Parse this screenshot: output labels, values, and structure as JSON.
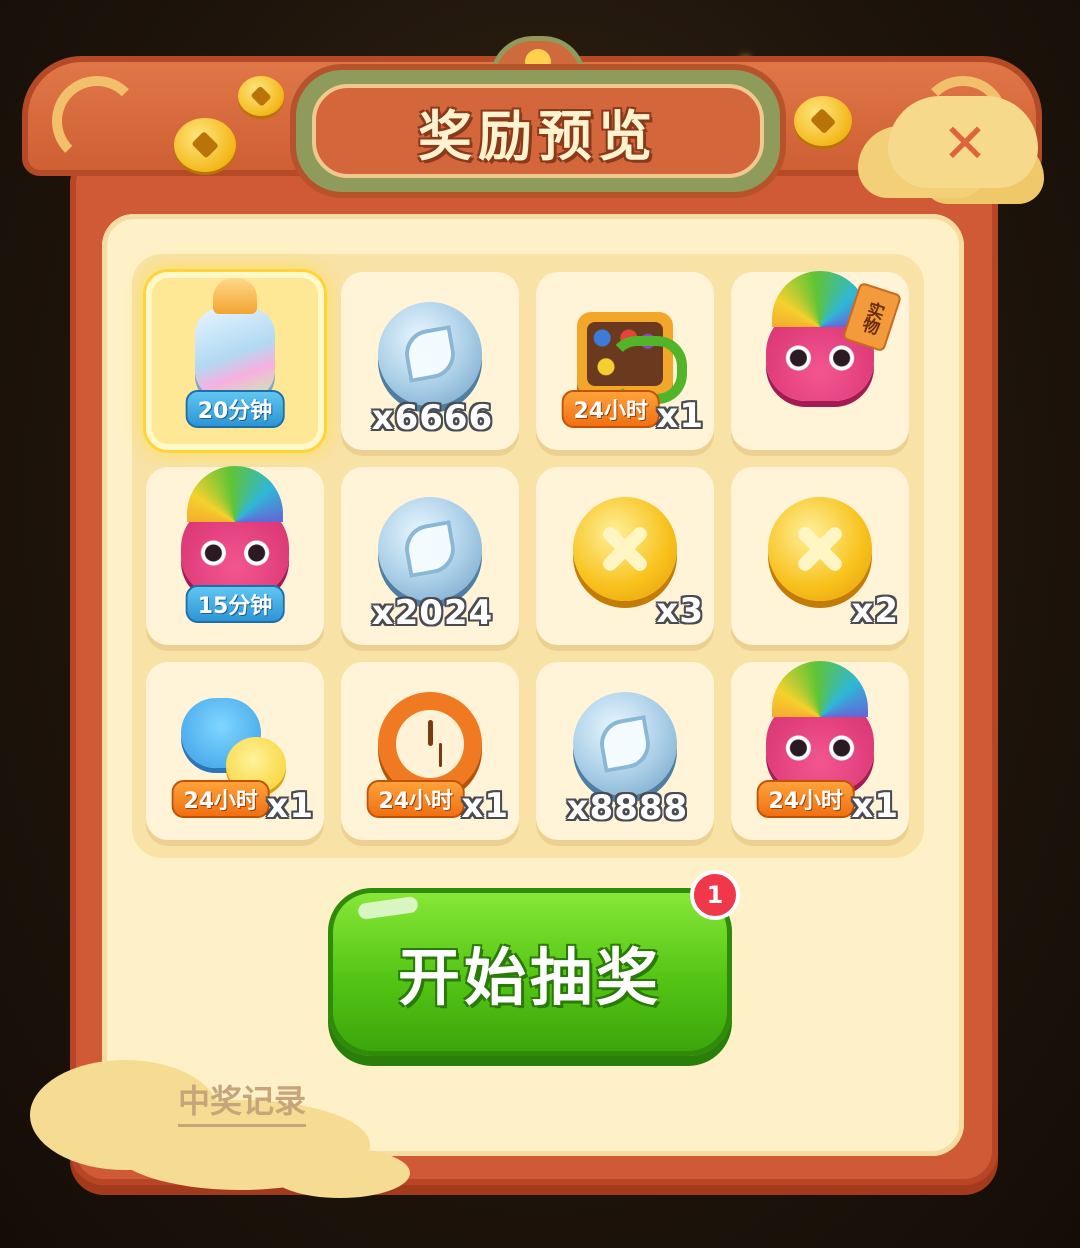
{
  "dialog": {
    "title": "奖励预览",
    "close_icon": "close-icon"
  },
  "rewards": [
    {
      "icon": "bottle-icon",
      "badge": "20分钟",
      "amount": "",
      "selected": true
    },
    {
      "icon": "leaf-coin-icon",
      "badge": "",
      "amount": "x6666"
    },
    {
      "icon": "puzzle-board-icon",
      "badge": "24小时",
      "amount": "x1"
    },
    {
      "icon": "bird-mask-icon",
      "badge": "",
      "amount": "",
      "tag": "实物"
    },
    {
      "icon": "bird-mask-icon",
      "badge": "15分钟",
      "amount": ""
    },
    {
      "icon": "leaf-coin-icon",
      "badge": "",
      "amount": "x2024"
    },
    {
      "icon": "gold-coin-icon",
      "badge": "",
      "amount": "x3"
    },
    {
      "icon": "gold-coin-icon",
      "badge": "",
      "amount": "x2"
    },
    {
      "icon": "hippo-chick-icon",
      "badge": "24小时",
      "amount": "x1"
    },
    {
      "icon": "clock-icon",
      "badge": "24小时",
      "amount": "x1"
    },
    {
      "icon": "leaf-coin-icon",
      "badge": "",
      "amount": "x8888"
    },
    {
      "icon": "bird-mask-icon",
      "badge": "24小时",
      "amount": "x1"
    }
  ],
  "start_button": {
    "label": "开始抽奖",
    "notification_count": "1"
  },
  "history_link": "中奖记录",
  "colors": {
    "frame": "#d05a36",
    "panel": "#fff1c7",
    "start_button": "#53c414",
    "badge": "#f0384a"
  }
}
